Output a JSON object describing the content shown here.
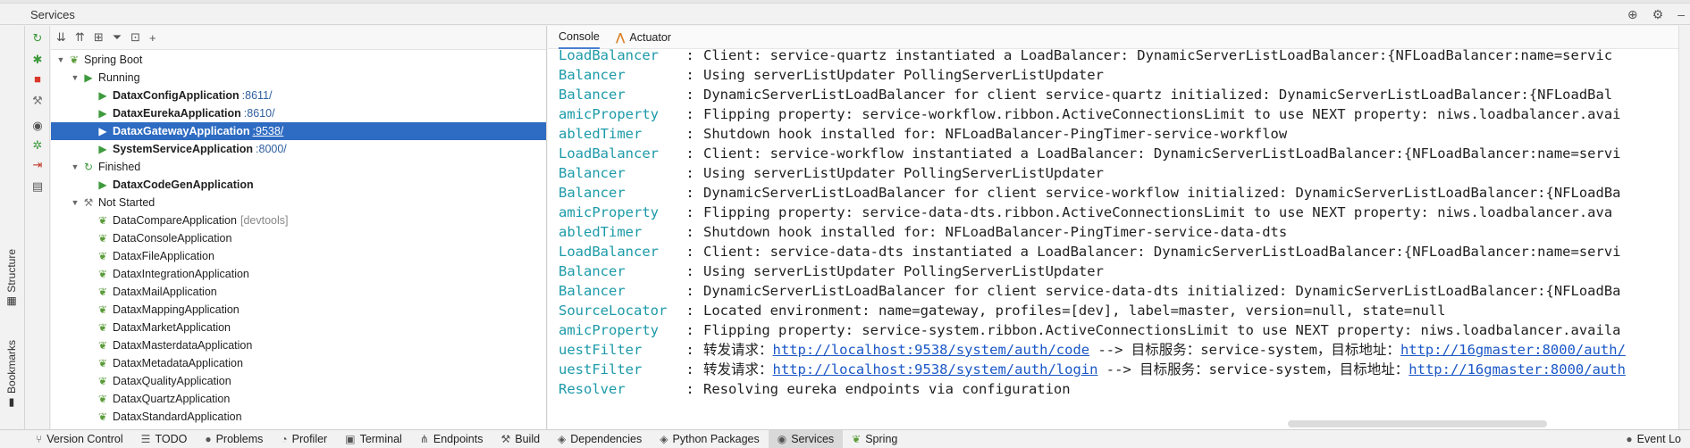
{
  "window": {
    "title": "Services"
  },
  "left_stripe": {
    "structure": "Structure",
    "bookmarks": "Bookmarks"
  },
  "tree": {
    "root": "Spring Boot",
    "running_group": "Running",
    "running": [
      {
        "name": "DataxConfigApplication",
        "port": ":8611/"
      },
      {
        "name": "DataxEurekaApplication",
        "port": ":8610/"
      },
      {
        "name": "DataxGatewayApplication",
        "port": ":9538/"
      },
      {
        "name": "SystemServiceApplication",
        "port": ":8000/"
      }
    ],
    "finished_group": "Finished",
    "finished": [
      {
        "name": "DataxCodeGenApplication"
      }
    ],
    "not_started_group": "Not Started",
    "not_started": [
      {
        "name": "DataCompareApplication",
        "tag": "[devtools]"
      },
      {
        "name": "DataConsoleApplication"
      },
      {
        "name": "DataxFileApplication"
      },
      {
        "name": "DataxIntegrationApplication"
      },
      {
        "name": "DataxMailApplication"
      },
      {
        "name": "DataxMappingApplication"
      },
      {
        "name": "DataxMarketApplication"
      },
      {
        "name": "DataxMasterdataApplication"
      },
      {
        "name": "DataxMetadataApplication"
      },
      {
        "name": "DataxQualityApplication"
      },
      {
        "name": "DataxQuartzApplication"
      },
      {
        "name": "DataxStandardApplication"
      }
    ]
  },
  "console_tabs": {
    "console": "Console",
    "actuator": "Actuator"
  },
  "log": [
    {
      "cls": "LoadBalancer",
      "msg": "Client: service-quartz instantiated a LoadBalancer: DynamicServerListLoadBalancer:{NFLoadBalancer:name=servic"
    },
    {
      "cls": "Balancer",
      "msg": "Using serverListUpdater PollingServerListUpdater"
    },
    {
      "cls": "Balancer",
      "msg": "DynamicServerListLoadBalancer for client service-quartz initialized: DynamicServerListLoadBalancer:{NFLoadBal"
    },
    {
      "cls": "amicProperty",
      "msg": "Flipping property: service-workflow.ribbon.ActiveConnectionsLimit to use NEXT property: niws.loadbalancer.avai"
    },
    {
      "cls": "abledTimer",
      "msg": "Shutdown hook installed for: NFLoadBalancer-PingTimer-service-workflow"
    },
    {
      "cls": "LoadBalancer",
      "msg": "Client: service-workflow instantiated a LoadBalancer: DynamicServerListLoadBalancer:{NFLoadBalancer:name=servi"
    },
    {
      "cls": "Balancer",
      "msg": "Using serverListUpdater PollingServerListUpdater"
    },
    {
      "cls": "Balancer",
      "msg": "DynamicServerListLoadBalancer for client service-workflow initialized: DynamicServerListLoadBalancer:{NFLoadBa"
    },
    {
      "cls": "amicProperty",
      "msg": "Flipping property: service-data-dts.ribbon.ActiveConnectionsLimit to use NEXT property: niws.loadbalancer.ava"
    },
    {
      "cls": "abledTimer",
      "msg": "Shutdown hook installed for: NFLoadBalancer-PingTimer-service-data-dts"
    },
    {
      "cls": "LoadBalancer",
      "msg": "Client: service-data-dts instantiated a LoadBalancer: DynamicServerListLoadBalancer:{NFLoadBalancer:name=servi"
    },
    {
      "cls": "Balancer",
      "msg": "Using serverListUpdater PollingServerListUpdater"
    },
    {
      "cls": "Balancer",
      "msg": "DynamicServerListLoadBalancer for client service-data-dts initialized: DynamicServerListLoadBalancer:{NFLoadBa"
    },
    {
      "cls": "SourceLocator",
      "msg": "Located environment: name=gateway, profiles=[dev], label=master, version=null, state=null"
    },
    {
      "cls": "amicProperty",
      "msg": "Flipping property: service-system.ribbon.ActiveConnectionsLimit to use NEXT property: niws.loadbalancer.availa"
    }
  ],
  "log_links": [
    {
      "cls": "uestFilter",
      "pre": "转发请求：",
      "url": "http://localhost:9538/system/auth/code",
      "mid": " --> 目标服务：service-system，目标地址：",
      "url2": "http://16gmaster:8000/auth/"
    },
    {
      "cls": "uestFilter",
      "pre": "转发请求：",
      "url": "http://localhost:9538/system/auth/login",
      "mid": " --> 目标服务：service-system，目标地址：",
      "url2": "http://16gmaster:8000/auth"
    }
  ],
  "log_last": {
    "cls": "Resolver",
    "msg": "Resolving eureka endpoints via configuration"
  },
  "bottom_tabs": [
    {
      "label": "Version Control",
      "icon": "branch-icon"
    },
    {
      "label": "TODO",
      "icon": "list-icon"
    },
    {
      "label": "Problems",
      "icon": "problems-icon"
    },
    {
      "label": "Profiler",
      "icon": "profiler-icon"
    },
    {
      "label": "Terminal",
      "icon": "terminal-icon"
    },
    {
      "label": "Endpoints",
      "icon": "endpoints-icon"
    },
    {
      "label": "Build",
      "icon": "hammer-icon"
    },
    {
      "label": "Dependencies",
      "icon": "dependencies-icon"
    },
    {
      "label": "Python Packages",
      "icon": "packages-icon"
    },
    {
      "label": "Services",
      "icon": "services-icon"
    },
    {
      "label": "Spring",
      "icon": "spring-icon"
    }
  ],
  "bottom_right": "Event Lo",
  "colors": {
    "selection": "#2e6bc2",
    "log_class": "#1b9aa8",
    "link": "#1a57c7",
    "run_green": "#3d9a3d"
  }
}
